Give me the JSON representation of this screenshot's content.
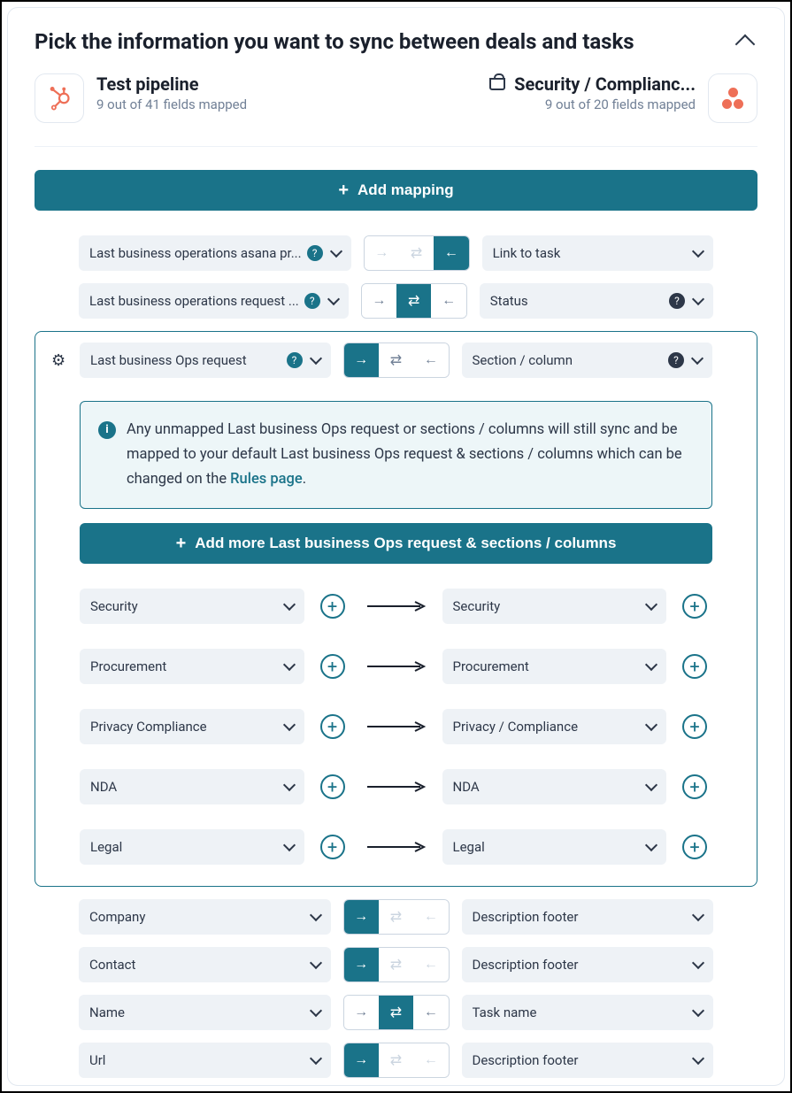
{
  "header": {
    "title": "Pick the information you want to sync between deals and tasks"
  },
  "left_source": {
    "title": "Test pipeline",
    "subtitle": "9 out of 41 fields mapped"
  },
  "right_source": {
    "title": "Security / Complianc...",
    "subtitle": "9 out of 20 fields mapped"
  },
  "buttons": {
    "add_mapping": "Add mapping",
    "add_more_sections": "Add more Last business Ops request & sections / columns"
  },
  "info_banner": {
    "text_before": "Any unmapped Last business Ops request or sections / columns will still sync and be mapped to your default Last business Ops request & sections / columns which can be changed on the ",
    "link": "Rules page",
    "text_after": "."
  },
  "rows_top": [
    {
      "left": "Last business operations asana pr...",
      "left_help": true,
      "right": "Link to task",
      "active": "left"
    },
    {
      "left": "Last business operations request ...",
      "left_help": true,
      "right": "Status",
      "right_help": true,
      "active": "both"
    }
  ],
  "expanded_row": {
    "left": "Last business Ops request",
    "right": "Section / column",
    "active": "right",
    "sub_rows": [
      {
        "left": "Security",
        "right": "Security"
      },
      {
        "left": "Procurement",
        "right": "Procurement"
      },
      {
        "left": "Privacy Compliance",
        "right": "Privacy / Compliance"
      },
      {
        "left": "NDA",
        "right": "NDA"
      },
      {
        "left": "Legal",
        "right": "Legal"
      }
    ]
  },
  "rows_bottom": [
    {
      "left": "Company",
      "right": "Description footer",
      "active": "right"
    },
    {
      "left": "Contact",
      "right": "Description footer",
      "active": "right"
    },
    {
      "left": "Name",
      "right": "Task name",
      "active": "both"
    },
    {
      "left": "Url",
      "right": "Description footer",
      "active": "right"
    }
  ]
}
